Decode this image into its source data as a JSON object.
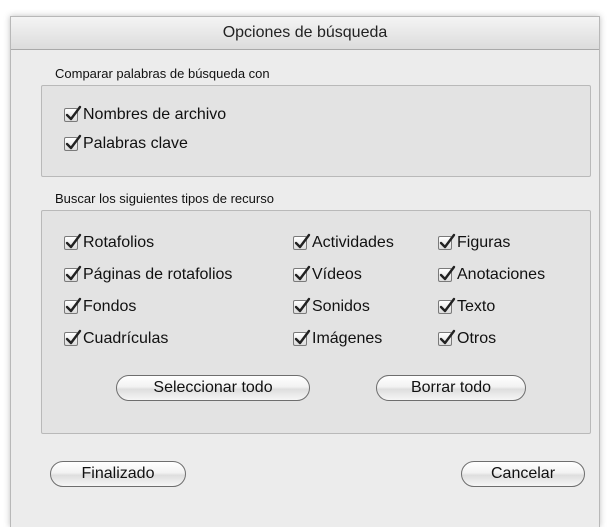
{
  "window": {
    "title": "Opciones de búsqueda"
  },
  "compare": {
    "label": "Comparar palabras de búsqueda con",
    "options": [
      {
        "label": "Nombres de archivo",
        "checked": true
      },
      {
        "label": "Palabras clave",
        "checked": true
      }
    ]
  },
  "resources": {
    "label": "Buscar los siguientes tipos de recurso",
    "options": [
      {
        "label": "Rotafolios",
        "checked": true
      },
      {
        "label": "Páginas de rotafolios",
        "checked": true
      },
      {
        "label": "Fondos",
        "checked": true
      },
      {
        "label": "Cuadrículas",
        "checked": true
      },
      {
        "label": "Actividades",
        "checked": true
      },
      {
        "label": "Vídeos",
        "checked": true
      },
      {
        "label": "Sonidos",
        "checked": true
      },
      {
        "label": "Imágenes",
        "checked": true
      },
      {
        "label": "Figuras",
        "checked": true
      },
      {
        "label": "Anotaciones",
        "checked": true
      },
      {
        "label": "Texto",
        "checked": true
      },
      {
        "label": "Otros",
        "checked": true
      }
    ],
    "select_all_label": "Seleccionar todo",
    "clear_all_label": "Borrar todo"
  },
  "footer": {
    "done_label": "Finalizado",
    "cancel_label": "Cancelar"
  },
  "icons": {
    "checkbox": "checkmark-icon"
  }
}
